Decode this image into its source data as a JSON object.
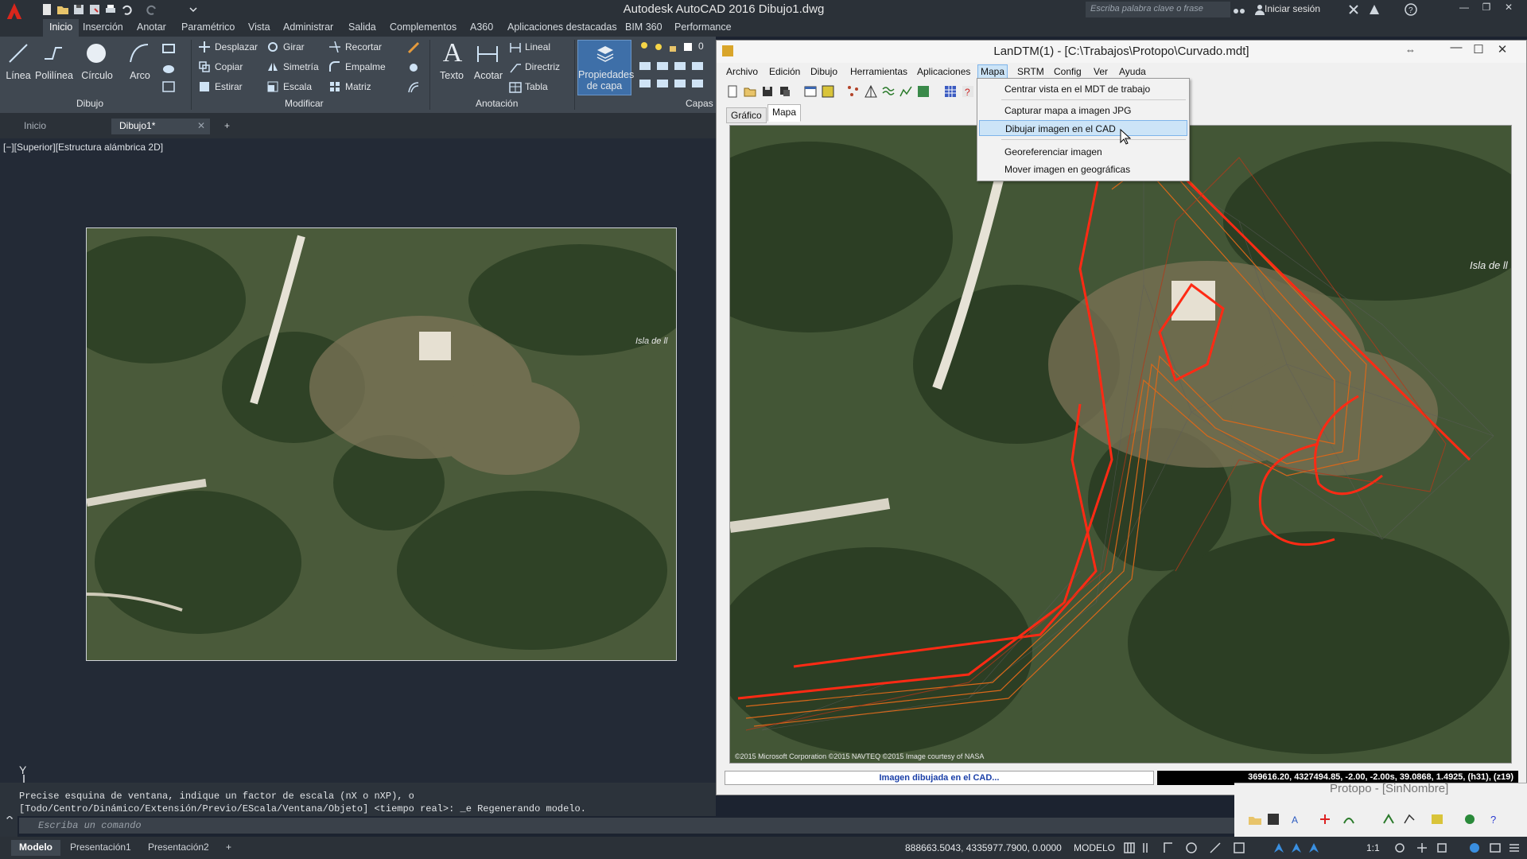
{
  "autocad": {
    "title": "Autodesk AutoCAD 2016    Dibujo1.dwg",
    "search_placeholder": "Escriba palabra clave o frase",
    "signin": "Iniciar sesión",
    "ribbon_tabs": [
      "Inicio",
      "Inserción",
      "Anotar",
      "Paramétrico",
      "Vista",
      "Administrar",
      "Salida",
      "Complementos",
      "A360",
      "Aplicaciones destacadas",
      "BIM 360",
      "Performance"
    ],
    "draw_tools": [
      "Línea",
      "Polilínea",
      "Círculo",
      "Arco"
    ],
    "modify_tools": [
      "Desplazar",
      "Girar",
      "Recortar",
      "Copiar",
      "Simetría",
      "Empalme",
      "Estirar",
      "Escala",
      "Matriz"
    ],
    "annot_tools": {
      "texto": "Texto",
      "acotar": "Acotar",
      "lineal": "Lineal",
      "directriz": "Directriz",
      "tabla": "Tabla"
    },
    "layer_props": {
      "line1": "Propiedades",
      "line2": "de capa"
    },
    "layer_zero": "0",
    "panels": {
      "dibujo": "Dibujo",
      "modificar": "Modificar",
      "anotacion": "Anotación",
      "capas": "Capas"
    },
    "file_tabs": {
      "home": "Inicio",
      "doc": "Dibujo1*"
    },
    "view_label": "[−][Superior][Estructura alámbrica 2D]",
    "photo_label": "Isla de ll",
    "ucs_label": "Y",
    "command_history": [
      "Precise esquina de ventana, indique un factor de escala (nX o nXP), o",
      "[Todo/Centro/Dinámico/Extensión/Previo/EScala/Ventana/Objeto] <tiempo real>: _e Regenerando modelo."
    ],
    "command_placeholder": "Escriba un comando",
    "layout_tabs": [
      "Modelo",
      "Presentación1",
      "Presentación2"
    ],
    "coords": "888663.5043, 4335977.7900, 0.0000",
    "mode": "MODELO",
    "scale": "1:1"
  },
  "landtm": {
    "title": "LanDTM(1) - [C:\\Trabajos\\Protopo\\Curvado.mdt]",
    "menus": [
      "Archivo",
      "Edición",
      "Dibujo",
      "Herramientas",
      "Aplicaciones",
      "Mapa",
      "SRTM",
      "Config",
      "Ver",
      "Ayuda"
    ],
    "view_tabs": [
      "Gráfico",
      "Mapa"
    ],
    "map_menu_items": [
      "Centrar vista en el MDT de trabajo",
      "Capturar mapa a imagen JPG",
      "Dibujar imagen en el CAD",
      "Georeferenciar imagen",
      "Mover imagen en geográficas"
    ],
    "map_label": "Isla de ll",
    "map_copyright": "©2015 Microsoft Corporation  ©2015 NAVTEQ  ©2015 Image courtesy of NASA",
    "status_message": "Imagen dibujada en el CAD...",
    "status_coords": "369616.20, 4327494.85, -2.00, -2.00s, 39.0868, 1.4925, (h31), (z19)"
  },
  "protopo": {
    "title": "Protopo - [SinNombre]"
  }
}
